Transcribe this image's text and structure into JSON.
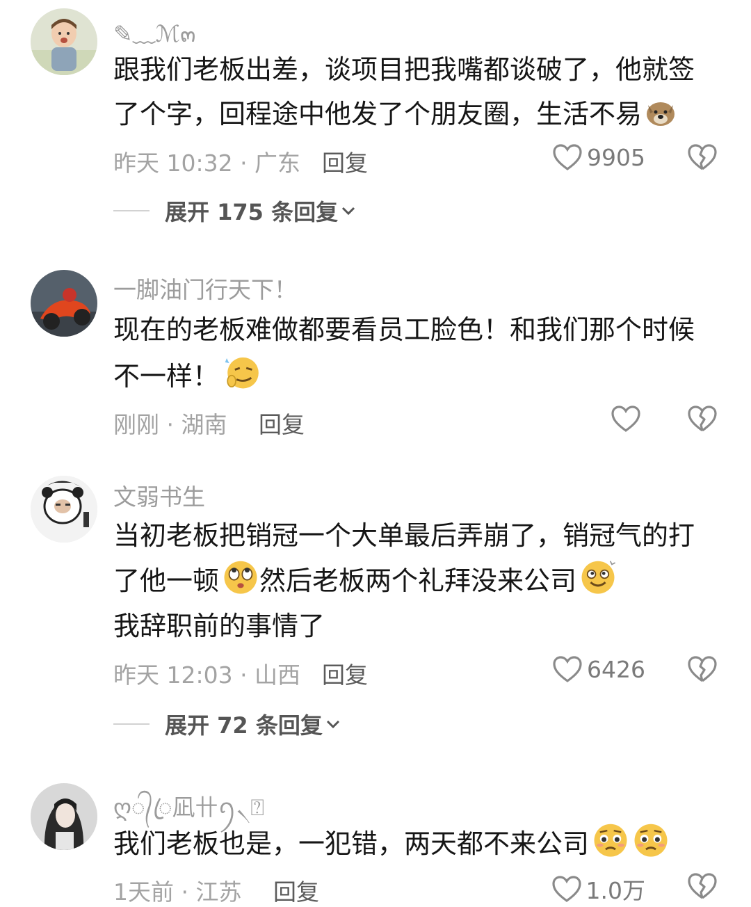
{
  "comments": [
    {
      "username": "✎﹏ℳ๓",
      "lines": [
        "跟我们老板出差，谈项目把我嘴都谈破了，他就签",
        "了个字，回程途中他发了个朋友圈，生活不易"
      ],
      "time": "昨天 10:32 · 广东",
      "reply": "回复",
      "likes": "9905",
      "expand": "展开 175 条回复",
      "emojis": [
        "dog-emoji"
      ]
    },
    {
      "username": "一脚油门行天下！",
      "lines": [
        "现在的老板难做都要看员工脸色！和我们那个时候",
        "不一样！"
      ],
      "time": "刚刚 · 湖南",
      "reply": "回复",
      "likes": "",
      "emojis": [
        "smirk-emoji"
      ]
    },
    {
      "username": "文弱书生",
      "lines": [
        "当初老板把销冠一个大单最后弄崩了，销冠气的打",
        "了他一顿",
        "然后老板两个礼拜没来公司",
        "我辞职前的事情了"
      ],
      "time": "昨天 12:03 · 山西",
      "reply": "回复",
      "likes": "6426",
      "expand": "展开 72 条回复",
      "emojis": [
        "rolling-eyes-emoji",
        "dizzy-smile-emoji"
      ]
    },
    {
      "username": "ღ᭄ꦿ凪卄ꪆ৲⍰",
      "lines": [
        "我们老板也是，一犯错，两天都不来公司"
      ],
      "time": "1天前 · 江苏",
      "reply": "回复",
      "likes": "1.0万",
      "emojis": [
        "pleading-emoji",
        "pleading-emoji"
      ]
    }
  ]
}
